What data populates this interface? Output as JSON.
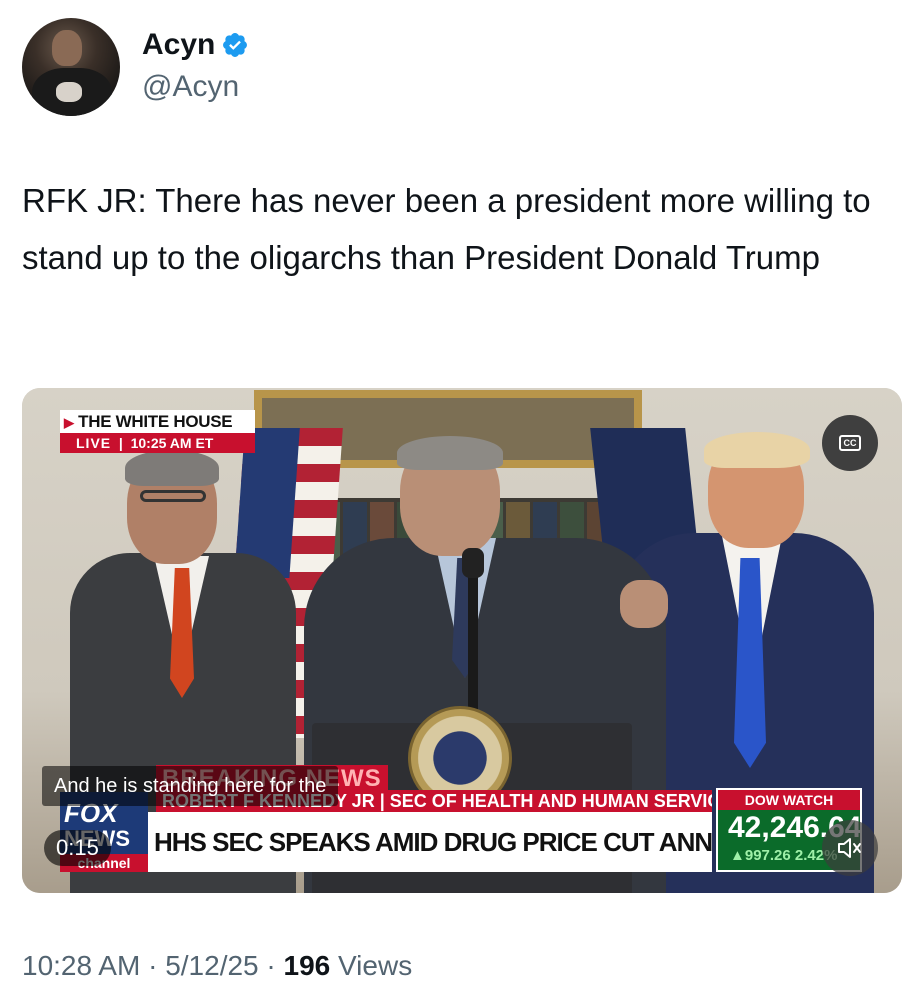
{
  "author": {
    "display_name": "Acyn",
    "handle": "@Acyn",
    "verified": true,
    "verified_color": "#1d9bf0"
  },
  "tweet": {
    "text": "RFK JR: There has never been a president more willing to stand up to the oligarchs than President Donald Trump"
  },
  "video": {
    "live_bug": {
      "location": "THE WHITE HOUSE",
      "live_label": "LIVE",
      "time": "10:25 AM ET"
    },
    "cc_label": "CC",
    "caption": "And he is standing here for the",
    "breaking_label": "BREAKING NEWS",
    "name_strip": "ROBERT F KENNEDY JR | SEC OF HEALTH AND HUMAN SERVICES",
    "headline": "HHS SEC SPEAKS AMID DRUG PRICE CUT ANNOUNCEMENT",
    "network": {
      "fox": "FOX",
      "news": "NEWS",
      "channel": "channel"
    },
    "dow": {
      "title": "DOW WATCH",
      "value": "42,246.64",
      "change": "▲997.26 2.42%"
    },
    "elapsed": "0:15",
    "muted": true
  },
  "meta": {
    "time": "10:28 AM",
    "separator": "·",
    "date": "5/12/25",
    "views_count": "196",
    "views_label": "Views"
  },
  "colors": {
    "text_primary": "#0f1419",
    "text_secondary": "#536471",
    "fox_red": "#c8102e",
    "fox_blue": "#1d3a78",
    "dow_green": "#0b6b2a"
  }
}
